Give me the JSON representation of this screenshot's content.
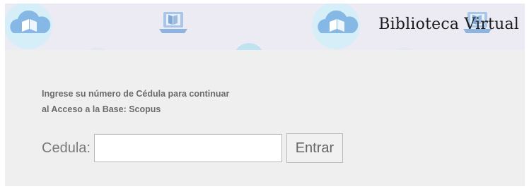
{
  "banner": {
    "title": "Biblioteca Virtual",
    "icons": [
      "cloud-book-icon",
      "laptop-book-icon",
      "cloud-book-icon",
      "laptop-book-icon"
    ]
  },
  "form": {
    "instruction_line1": "Ingrese su número de Cédula para continuar",
    "instruction_line2": "al Acceso a la Base: Scopus",
    "cedula_label": "Cedula:",
    "cedula_value": "",
    "submit_label": "Entrar"
  },
  "colors": {
    "banner_bg": "#ecebf4",
    "panel_bg": "#efefef",
    "icon_blue": "#7fb3e6",
    "icon_glow": "#cfeaf5"
  }
}
